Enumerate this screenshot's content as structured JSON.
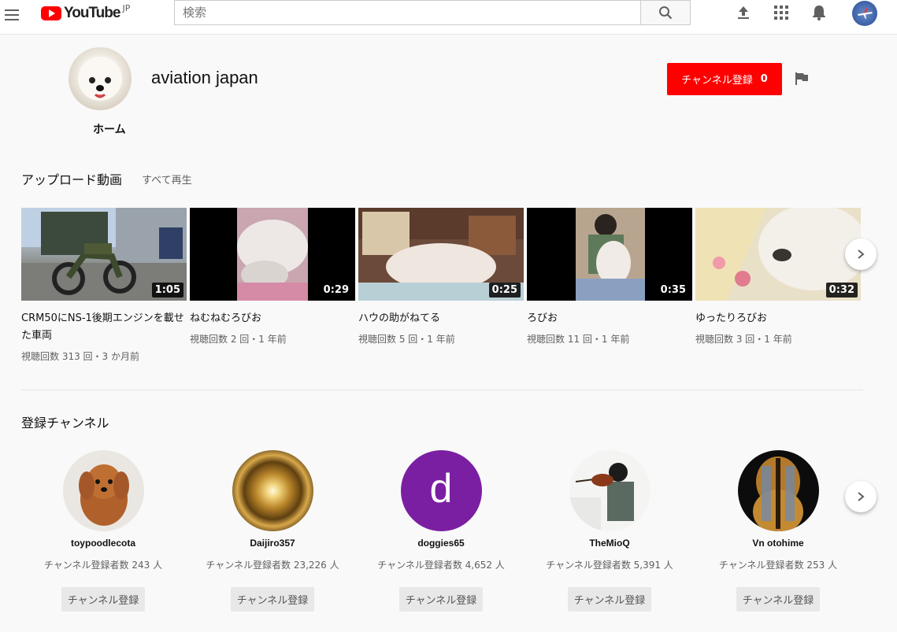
{
  "header": {
    "logo_text": "YouTube",
    "logo_region": "JP",
    "search_placeholder": "検索"
  },
  "channel": {
    "title": "aviation japan",
    "home_tab": "ホーム",
    "subscribe_label": "チャンネル登録",
    "subscriber_count": "0"
  },
  "uploads": {
    "heading": "アップロード動画",
    "play_all": "すべて再生",
    "videos": [
      {
        "title": "CRM50にNS-1後期エンジンを載せた車両",
        "duration": "1:05",
        "meta": "視聴回数 313 回・3 か月前"
      },
      {
        "title": "ねむねむろびお",
        "duration": "0:29",
        "meta": "視聴回数 2 回・1 年前"
      },
      {
        "title": "ハウの助がねてる",
        "duration": "0:25",
        "meta": "視聴回数 5 回・1 年前"
      },
      {
        "title": "ろびお",
        "duration": "0:35",
        "meta": "視聴回数 11 回・1 年前"
      },
      {
        "title": "ゆったりろびお",
        "duration": "0:32",
        "meta": "視聴回数 3 回・1 年前"
      }
    ]
  },
  "subscriptions": {
    "heading": "登録チャンネル",
    "channels": [
      {
        "name": "toypoodlecota",
        "subs": "チャンネル登録者数 243 人",
        "button": "チャンネル登録"
      },
      {
        "name": "Daijiro357",
        "subs": "チャンネル登録者数 23,226 人",
        "button": "チャンネル登録"
      },
      {
        "name": "doggies65",
        "subs": "チャンネル登録者数 4,652 人",
        "button": "チャンネル登録",
        "initial": "d"
      },
      {
        "name": "TheMioQ",
        "subs": "チャンネル登録者数 5,391 人",
        "button": "チャンネル登録"
      },
      {
        "name": "Vn otohime",
        "subs": "チャンネル登録者数 253 人",
        "button": "チャンネル登録"
      }
    ]
  },
  "colors": {
    "brand_red": "#ff0000",
    "doggies_purple": "#7b1fa2"
  }
}
